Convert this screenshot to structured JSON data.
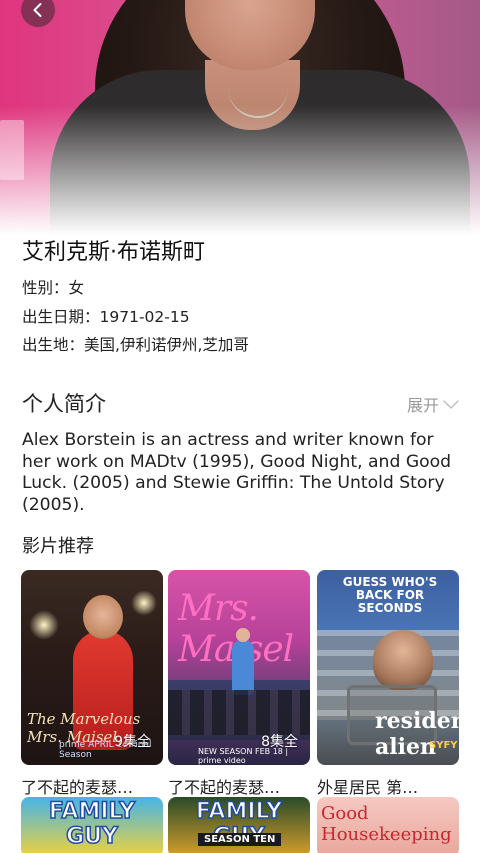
{
  "person": {
    "name": "艾利克斯·布诺斯町",
    "gender_label": "性别：",
    "gender": "女",
    "birth_label": "出生日期：",
    "birth_date": "1971-02-15",
    "birthplace_label": "出生地：",
    "birthplace": "美国,伊利诺伊州,芝加哥"
  },
  "bio": {
    "section_title": "个人简介",
    "expand_label": "展开",
    "text": "Alex Borstein is an actress and writer known for her work on MADtv (1995), Good Night, and Good Luck. (2005) and Stewie Griffin: The Untold Story (2005)."
  },
  "recommendations": {
    "title": "影片推荐",
    "items": [
      {
        "title": "了不起的麦瑟…",
        "episodes": "9集全",
        "art_text": "The Marvelous Mrs. Maisel",
        "art_sub": "prime  APRIL 14 Final Season"
      },
      {
        "title": "了不起的麦瑟…",
        "episodes": "8集全",
        "art_text": "Mrs. Maisel",
        "art_sub": "NEW SEASON FEB 18 | prime video"
      },
      {
        "title": "外星居民 第…",
        "episodes": "",
        "art_text": "GUESS WHO'S BACK FOR SECONDS",
        "art_sub": "resident alien",
        "art_sub2": "SYFY"
      },
      {
        "title": "",
        "episodes": "",
        "art_text": "FAMILY GUY"
      },
      {
        "title": "",
        "episodes": "",
        "art_text": "FAMILY GUY",
        "art_sub": "SEASON TEN"
      },
      {
        "title": "",
        "episodes": "",
        "art_text": "Good Housekeeping"
      }
    ]
  },
  "icons": {
    "back": "chevron-left-icon",
    "expand": "chevron-down-icon"
  }
}
